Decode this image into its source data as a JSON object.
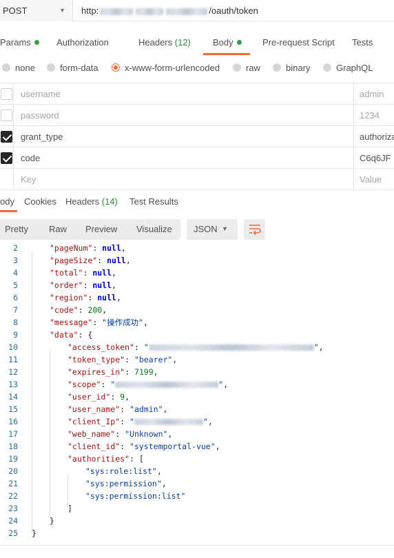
{
  "request": {
    "method": "POST",
    "url_prefix": "http:",
    "url_suffix": "/oauth/token"
  },
  "request_tabs": [
    {
      "label": "Params",
      "has_dot": true
    },
    {
      "label": "Authorization"
    },
    {
      "label": "Headers",
      "count": "(12)"
    },
    {
      "label": "Body",
      "has_dot": true,
      "active": true
    },
    {
      "label": "Pre-request Script"
    },
    {
      "label": "Tests"
    }
  ],
  "body_types": [
    "none",
    "form-data",
    "x-www-form-urlencoded",
    "raw",
    "binary",
    "GraphQL"
  ],
  "body_type_selected": "x-www-form-urlencoded",
  "params": [
    {
      "checked": false,
      "key": "username",
      "value": "admin",
      "dim": true
    },
    {
      "checked": false,
      "key": "password",
      "value": "1234",
      "dim": true
    },
    {
      "checked": true,
      "key": "grant_type",
      "value": "authoriza"
    },
    {
      "checked": true,
      "key": "code",
      "value": "C6q6JF"
    },
    {
      "checked": false,
      "key": "Key",
      "value": "Value",
      "placeholder": true
    }
  ],
  "response_tabs": [
    {
      "label": "ody",
      "active": true
    },
    {
      "label": "Cookies"
    },
    {
      "label": "Headers",
      "count": "(14)"
    },
    {
      "label": "Test Results"
    }
  ],
  "view_modes": [
    "Pretty",
    "Raw",
    "Preview",
    "Visualize"
  ],
  "format_selected": "JSON",
  "icons": {
    "method_caret": "chevron-down-icon",
    "format_caret": "chevron-down-icon",
    "wrap": "wrap-lines-icon"
  },
  "colors": {
    "accent": "#f26b3a",
    "dot": "#2fa043"
  },
  "code_lines": [
    {
      "n": "2",
      "indent": 1,
      "parts": [
        [
          "k",
          "\"pageNum\""
        ],
        [
          "p",
          ": "
        ],
        [
          "nl",
          "null"
        ],
        [
          "p",
          ","
        ]
      ]
    },
    {
      "n": "3",
      "indent": 1,
      "parts": [
        [
          "k",
          "\"pageSize\""
        ],
        [
          "p",
          ": "
        ],
        [
          "nl",
          "null"
        ],
        [
          "p",
          ","
        ]
      ]
    },
    {
      "n": "4",
      "indent": 1,
      "parts": [
        [
          "k",
          "\"total\""
        ],
        [
          "p",
          ": "
        ],
        [
          "nl",
          "null"
        ],
        [
          "p",
          ","
        ]
      ]
    },
    {
      "n": "5",
      "indent": 1,
      "parts": [
        [
          "k",
          "\"order\""
        ],
        [
          "p",
          ": "
        ],
        [
          "nl",
          "null"
        ],
        [
          "p",
          ","
        ]
      ]
    },
    {
      "n": "6",
      "indent": 1,
      "parts": [
        [
          "k",
          "\"region\""
        ],
        [
          "p",
          ": "
        ],
        [
          "nl",
          "null"
        ],
        [
          "p",
          ","
        ]
      ]
    },
    {
      "n": "7",
      "indent": 1,
      "parts": [
        [
          "k",
          "\"code\""
        ],
        [
          "p",
          ": "
        ],
        [
          "n",
          "200"
        ],
        [
          "p",
          ","
        ]
      ]
    },
    {
      "n": "8",
      "indent": 1,
      "parts": [
        [
          "k",
          "\"message\""
        ],
        [
          "p",
          ": "
        ],
        [
          "s",
          "\"操作成功\""
        ],
        [
          "p",
          ","
        ]
      ]
    },
    {
      "n": "9",
      "indent": 1,
      "parts": [
        [
          "k",
          "\"data\""
        ],
        [
          "p",
          ": {"
        ]
      ]
    },
    {
      "n": "10",
      "indent": 2,
      "parts": [
        [
          "k",
          "\"access_token\""
        ],
        [
          "p",
          ": "
        ],
        [
          "s",
          "\""
        ],
        [
          "b",
          "240"
        ],
        [
          "s",
          "\""
        ],
        [
          "p",
          ","
        ]
      ]
    },
    {
      "n": "11",
      "indent": 2,
      "parts": [
        [
          "k",
          "\"token_type\""
        ],
        [
          "p",
          ": "
        ],
        [
          "s",
          "\"bearer\""
        ],
        [
          "p",
          ","
        ]
      ]
    },
    {
      "n": "12",
      "indent": 2,
      "parts": [
        [
          "k",
          "\"expires_in\""
        ],
        [
          "p",
          ": "
        ],
        [
          "n",
          "7199"
        ],
        [
          "p",
          ","
        ]
      ]
    },
    {
      "n": "13",
      "indent": 2,
      "parts": [
        [
          "k",
          "\"scope\""
        ],
        [
          "p",
          ": "
        ],
        [
          "s",
          "\""
        ],
        [
          "b",
          "150"
        ],
        [
          "s",
          "\""
        ],
        [
          "p",
          ","
        ]
      ]
    },
    {
      "n": "14",
      "indent": 2,
      "parts": [
        [
          "k",
          "\"user_id\""
        ],
        [
          "p",
          ": "
        ],
        [
          "n",
          "9"
        ],
        [
          "p",
          ","
        ]
      ]
    },
    {
      "n": "15",
      "indent": 2,
      "parts": [
        [
          "k",
          "\"user_name\""
        ],
        [
          "p",
          ": "
        ],
        [
          "s",
          "\"admin\""
        ],
        [
          "p",
          ","
        ]
      ]
    },
    {
      "n": "16",
      "indent": 2,
      "parts": [
        [
          "k",
          "\"client_Ip\""
        ],
        [
          "p",
          ": "
        ],
        [
          "s",
          "\""
        ],
        [
          "b",
          "100"
        ],
        [
          "s",
          "\""
        ],
        [
          "p",
          ","
        ]
      ]
    },
    {
      "n": "17",
      "indent": 2,
      "parts": [
        [
          "k",
          "\"web_name\""
        ],
        [
          "p",
          ": "
        ],
        [
          "s",
          "\"Unknown\""
        ],
        [
          "p",
          ","
        ]
      ]
    },
    {
      "n": "18",
      "indent": 2,
      "parts": [
        [
          "k",
          "\"client_id\""
        ],
        [
          "p",
          ": "
        ],
        [
          "s",
          "\"systemportal-vue\""
        ],
        [
          "p",
          ","
        ]
      ]
    },
    {
      "n": "19",
      "indent": 2,
      "parts": [
        [
          "k",
          "\"authorities\""
        ],
        [
          "p",
          ": ["
        ]
      ]
    },
    {
      "n": "20",
      "indent": 3,
      "parts": [
        [
          "s",
          "\"sys:role:list\""
        ],
        [
          "p",
          ","
        ]
      ]
    },
    {
      "n": "21",
      "indent": 3,
      "parts": [
        [
          "s",
          "\"sys:permission\""
        ],
        [
          "p",
          ","
        ]
      ]
    },
    {
      "n": "22",
      "indent": 3,
      "parts": [
        [
          "s",
          "\"sys:permission:list\""
        ]
      ]
    },
    {
      "n": "23",
      "indent": 2,
      "parts": [
        [
          "p",
          "]"
        ]
      ]
    },
    {
      "n": "24",
      "indent": 1,
      "parts": [
        [
          "p",
          "}"
        ]
      ]
    },
    {
      "n": "25",
      "indent": 0,
      "parts": [
        [
          "p",
          "}"
        ]
      ]
    }
  ]
}
